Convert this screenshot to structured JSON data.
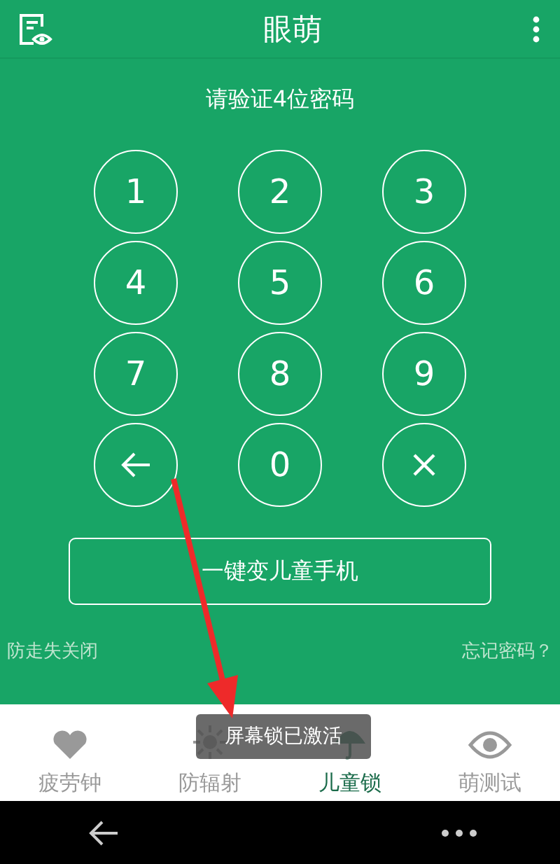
{
  "header": {
    "title": "眼萌"
  },
  "prompt": "请验证4位密码",
  "keys": [
    {
      "kind": "digit",
      "label": "1"
    },
    {
      "kind": "digit",
      "label": "2"
    },
    {
      "kind": "digit",
      "label": "3"
    },
    {
      "kind": "digit",
      "label": "4"
    },
    {
      "kind": "digit",
      "label": "5"
    },
    {
      "kind": "digit",
      "label": "6"
    },
    {
      "kind": "digit",
      "label": "7"
    },
    {
      "kind": "digit",
      "label": "8"
    },
    {
      "kind": "digit",
      "label": "9"
    },
    {
      "kind": "back"
    },
    {
      "kind": "digit",
      "label": "0"
    },
    {
      "kind": "clear"
    }
  ],
  "main_button": "一键变儿童手机",
  "left_link": "防走失关闭",
  "right_link": "忘记密码？",
  "tabs": [
    {
      "kind": "heart",
      "label": "疲劳钟",
      "selected": false
    },
    {
      "kind": "sun",
      "label": "防辐射",
      "selected": false
    },
    {
      "kind": "umbrella",
      "label": "儿童锁",
      "selected": true
    },
    {
      "kind": "eye",
      "label": "萌测试",
      "selected": false
    }
  ],
  "toast": "屏幕锁已激活"
}
